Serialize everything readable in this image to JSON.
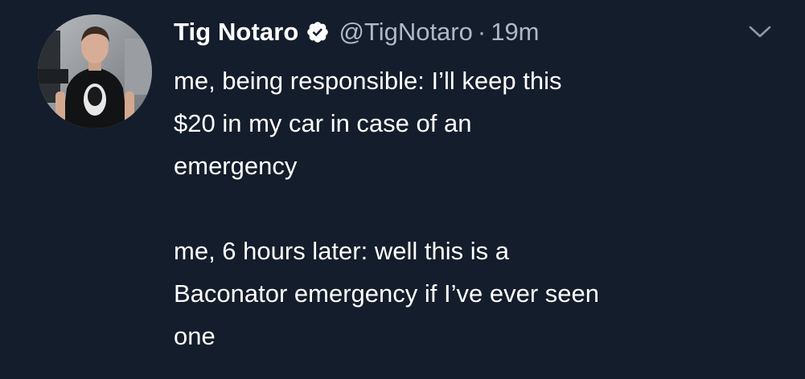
{
  "tweet": {
    "author": {
      "display_name": "Tig Notaro",
      "handle": "@TigNotaro",
      "verified": true,
      "avatar_icon": "profile-photo"
    },
    "separator": "·",
    "timestamp": "19m",
    "menu_icon": "chevron-down-icon",
    "text": {
      "paragraph_1": [
        "me, being responsible: I’ll keep this",
        "$20 in my car in case of an",
        "emergency"
      ],
      "paragraph_2": [
        "me, 6 hours later: well this is a",
        "Baconator emergency if I’ve ever seen",
        "one"
      ]
    }
  },
  "colors": {
    "background": "#141d2b",
    "primary_text": "#ffffff",
    "secondary_text": "#aeb9c5",
    "verified": "#ffffff"
  }
}
